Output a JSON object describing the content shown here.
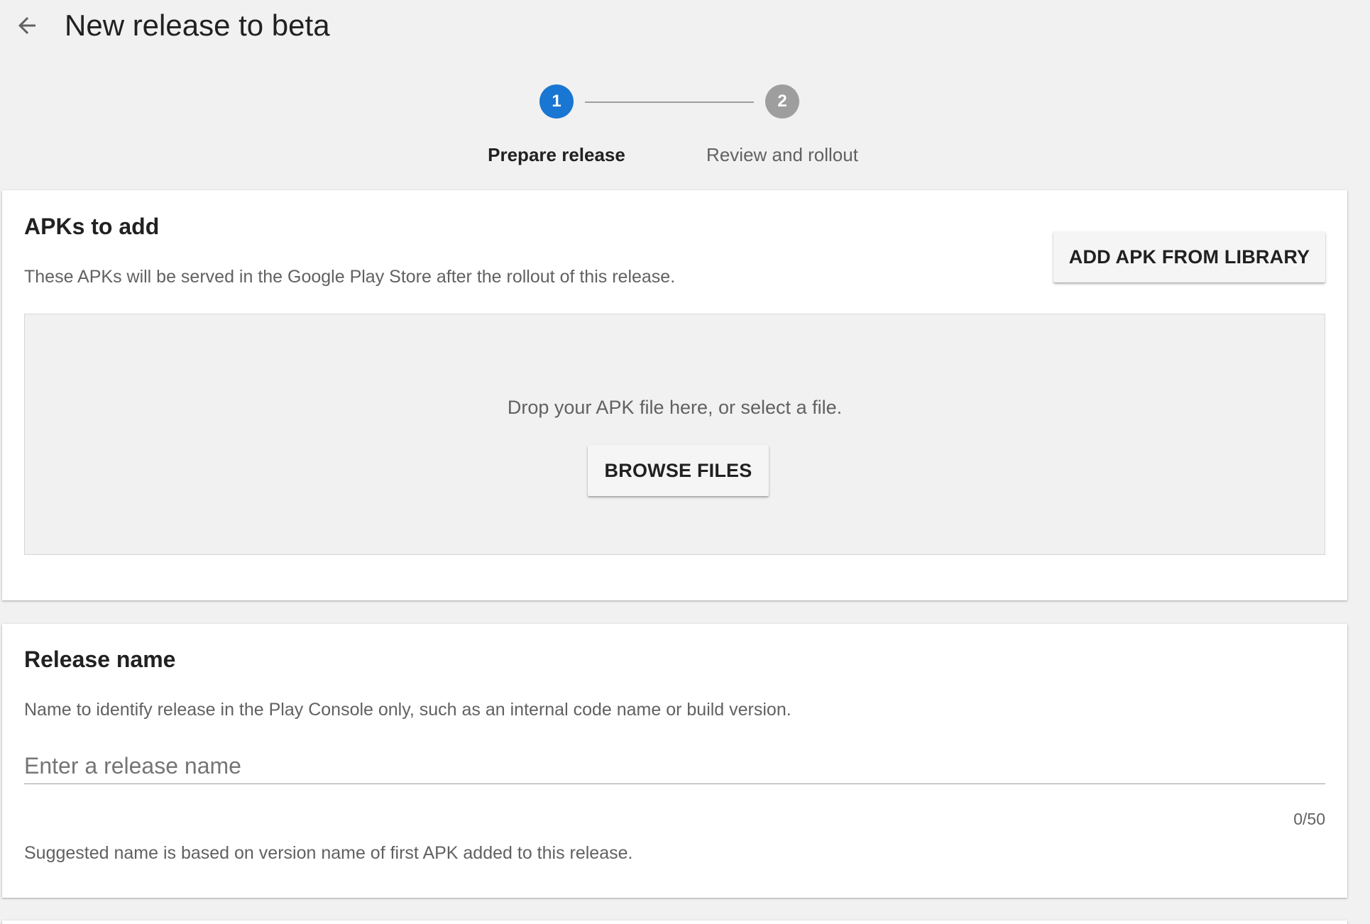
{
  "header": {
    "back_icon": "arrow-left-icon",
    "title": "New release to beta"
  },
  "stepper": {
    "steps": [
      {
        "number": "1",
        "label": "Prepare release",
        "state": "active"
      },
      {
        "number": "2",
        "label": "Review and rollout",
        "state": "inactive"
      }
    ]
  },
  "apk_card": {
    "title": "APKs to add",
    "description": "These APKs will be served in the Google Play Store after the rollout of this release.",
    "add_from_library_label": "ADD APK FROM LIBRARY",
    "dropzone_text": "Drop your APK file here, or select a file.",
    "browse_label": "BROWSE FILES"
  },
  "release_card": {
    "title": "Release name",
    "description": "Name to identify release in the Play Console only, such as an internal code name or build version.",
    "input_placeholder": "Enter a release name",
    "input_value": "",
    "char_count": "0/50",
    "hint": "Suggested name is based on version name of first APK added to this release."
  },
  "colors": {
    "accent": "#1976d2",
    "inactive_step": "#9e9e9e",
    "background": "#f1f1f1"
  }
}
